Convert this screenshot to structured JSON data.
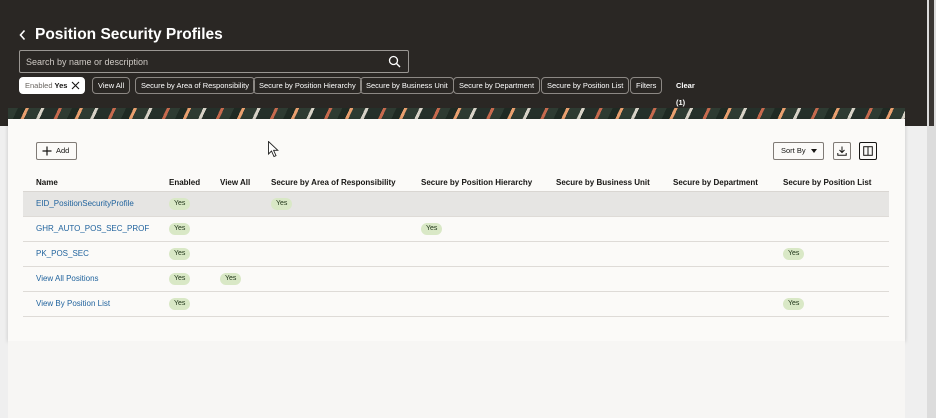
{
  "header": {
    "title": "Position Security Profiles",
    "search_placeholder": "Search by name or description"
  },
  "filters": {
    "enabled_chip": {
      "label": "Enabled",
      "value": "Yes"
    },
    "chips": [
      "View All",
      "Secure by Area of Responsibility",
      "Secure by Position Hierarchy",
      "Secure by Business Unit",
      "Secure by Department",
      "Secure by Position List",
      "Filters"
    ],
    "clear_label": "Clear (1)"
  },
  "toolbar": {
    "add_label": "Add",
    "sort_label": "Sort By"
  },
  "table": {
    "columns": [
      "Name",
      "Enabled",
      "View All",
      "Secure by Area of Responsibility",
      "Secure by Position Hierarchy",
      "Secure by Business Unit",
      "Secure by Department",
      "Secure by Position List"
    ],
    "rows": [
      {
        "name": "EID_PositionSecurityProfile",
        "enabled": "Yes",
        "view_all": "",
        "area": "Yes",
        "hierarchy": "",
        "bu": "",
        "dept": "",
        "list": ""
      },
      {
        "name": "GHR_AUTO_POS_SEC_PROF",
        "enabled": "Yes",
        "view_all": "",
        "area": "",
        "hierarchy": "Yes",
        "bu": "",
        "dept": "",
        "list": ""
      },
      {
        "name": "PK_POS_SEC",
        "enabled": "Yes",
        "view_all": "",
        "area": "",
        "hierarchy": "",
        "bu": "",
        "dept": "",
        "list": "Yes"
      },
      {
        "name": "View All Positions",
        "enabled": "Yes",
        "view_all": "Yes",
        "area": "",
        "hierarchy": "",
        "bu": "",
        "dept": "",
        "list": ""
      },
      {
        "name": "View By Position List",
        "enabled": "Yes",
        "view_all": "",
        "area": "",
        "hierarchy": "",
        "bu": "",
        "dept": "",
        "list": "Yes"
      }
    ]
  },
  "colors": {
    "header_bg": "#2a2724",
    "link": "#22649e",
    "badge_bg": "#d9e8c6"
  }
}
